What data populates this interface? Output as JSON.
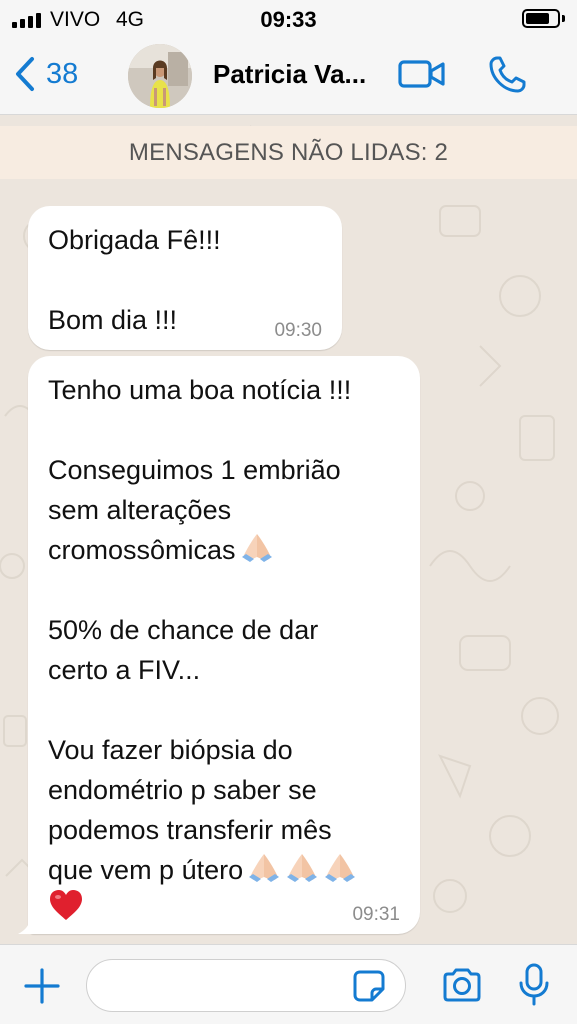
{
  "status_bar": {
    "carrier": "VIVO",
    "network": "4G",
    "time": "09:33",
    "signal_bars": 4,
    "battery_level": 0.75
  },
  "header": {
    "back_count": "38",
    "contact_name": "Patricia Va...",
    "back_icon": "chevron-left-icon",
    "video_icon": "video-camera-icon",
    "call_icon": "phone-icon"
  },
  "chat": {
    "unread_banner": "MENSAGENS NÃO LIDAS: 2",
    "messages": [
      {
        "lines": [
          "Obrigada Fê!!!",
          "",
          "Bom dia !!!"
        ],
        "time": "09:30"
      },
      {
        "lines": [
          "Tenho uma boa notícia !!!",
          "",
          "Conseguimos 1 embrião",
          "sem alterações",
          "cromossômicas",
          "",
          "50% de chance de dar",
          "certo a FIV...",
          "",
          "Vou fazer biópsia do",
          "endométrio p saber se",
          "podemos transferir mês",
          "que vem p útero"
        ],
        "emoji": [
          "folded-hands",
          "folded-hands",
          "folded-hands",
          "folded-hands",
          "red-heart"
        ],
        "time": "09:31"
      }
    ]
  },
  "input_bar": {
    "placeholder": "",
    "icons": [
      "plus-icon",
      "sticker-icon",
      "camera-icon",
      "microphone-icon"
    ]
  },
  "colors": {
    "accent": "#147bd1",
    "chat_background": "#ece5dd",
    "unread_banner": "#f7ece1",
    "bubble": "#ffffff",
    "heart": "#e0202e"
  }
}
